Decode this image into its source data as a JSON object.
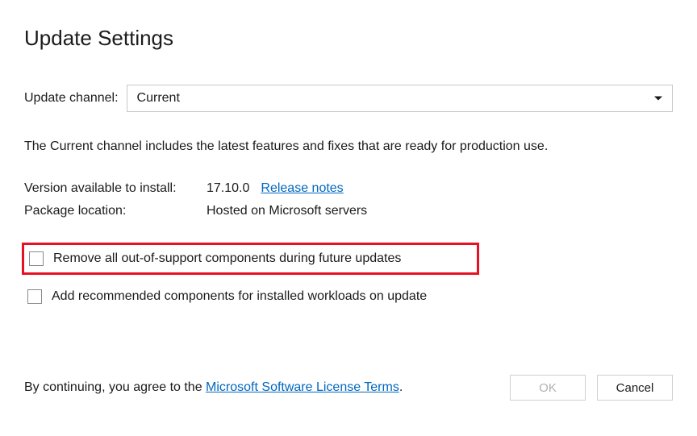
{
  "title": "Update Settings",
  "channel": {
    "label": "Update channel:",
    "value": "Current"
  },
  "description": "The Current channel includes the latest features and fixes that are ready for production use.",
  "version": {
    "label": "Version available to install:",
    "value": "17.10.0",
    "release_notes": "Release notes"
  },
  "package": {
    "label": "Package location:",
    "value": "Hosted on Microsoft servers"
  },
  "checkboxes": {
    "remove_oos": "Remove all out-of-support components during future updates",
    "add_recommended": "Add recommended components for installed workloads on update"
  },
  "footer": {
    "agree_prefix": "By continuing, you agree to the ",
    "license_link": "Microsoft Software License Terms",
    "period": "."
  },
  "buttons": {
    "ok": "OK",
    "cancel": "Cancel"
  }
}
